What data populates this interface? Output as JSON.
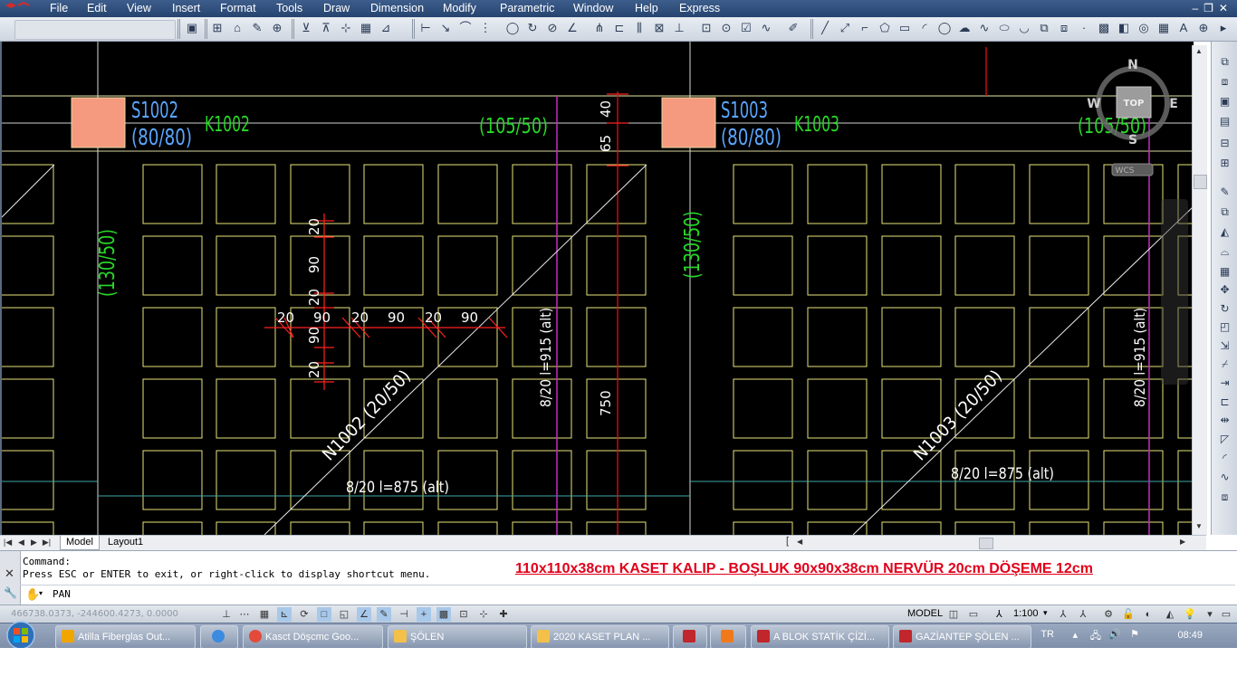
{
  "menu": {
    "items": [
      "File",
      "Edit",
      "View",
      "Insert",
      "Format",
      "Tools",
      "Draw",
      "Dimension",
      "Modify",
      "Parametric",
      "Window",
      "Help",
      "Express"
    ]
  },
  "drawing": {
    "columns": [
      {
        "name": "S1002",
        "size": "(80/80)"
      },
      {
        "name": "S1003",
        "size": "(80/80)"
      }
    ],
    "beams": [
      {
        "name": "K1002"
      },
      {
        "name": "K1003"
      }
    ],
    "beam_sizes": [
      "(105/50)",
      "(105/50)",
      "(130/50)",
      "(130/50)"
    ],
    "ribs": [
      "N1002 (20/50)",
      "N1003 (20/50)"
    ],
    "rebar_labels": [
      "8/20  l=875 (alt)",
      "8/20  l=875 (alt)",
      "8/20  l=915 (alt)",
      "8/20  l=915 (alt)"
    ],
    "dims_h": [
      "20",
      "90",
      "20",
      "90",
      "20",
      "90"
    ],
    "dims_v": [
      "20",
      "90",
      "20",
      "90",
      "20"
    ],
    "dims_misc": [
      "40",
      "65",
      "750"
    ],
    "viewcube": {
      "n": "N",
      "s": "S",
      "e": "E",
      "w": "W",
      "top": "TOP",
      "wcs": "WCS"
    }
  },
  "tabs": [
    "Model",
    "Layout1"
  ],
  "command": {
    "line1": "Command:",
    "line2": "Press ESC or ENTER to exit, or right-click to display shortcut menu.",
    "current": "PAN",
    "title": "110x110x38cm KASET KALIP - BOŞLUK 90x90x38cm NERVÜR 20cm DÖŞEME 12cm"
  },
  "status": {
    "coords": "466738.0373, -244600.4273, 0.0000",
    "model": "MODEL",
    "scale": "1:100"
  },
  "taskbar": {
    "items": [
      {
        "label": "Atilla Fiberglas  Out...",
        "color": "#f0a500"
      },
      {
        "label": "",
        "color": "#3b8be0"
      },
      {
        "label": "Kasct Döşcmc   Goo...",
        "color": "#e44a3a"
      },
      {
        "label": "ŞÖLEN",
        "color": "#f3c04a"
      },
      {
        "label": "2020 KASET PLAN ...",
        "color": "#f3c04a"
      },
      {
        "label": "",
        "color": "#c0262b"
      },
      {
        "label": "",
        "color": "#f07a1a"
      },
      {
        "label": "A BLOK STATİK ÇİZİ...",
        "color": "#c0262b"
      },
      {
        "label": "GAZİANTEP ŞÖLEN ...",
        "color": "#c0262b"
      }
    ],
    "lang": "TR",
    "time": "08:49"
  }
}
